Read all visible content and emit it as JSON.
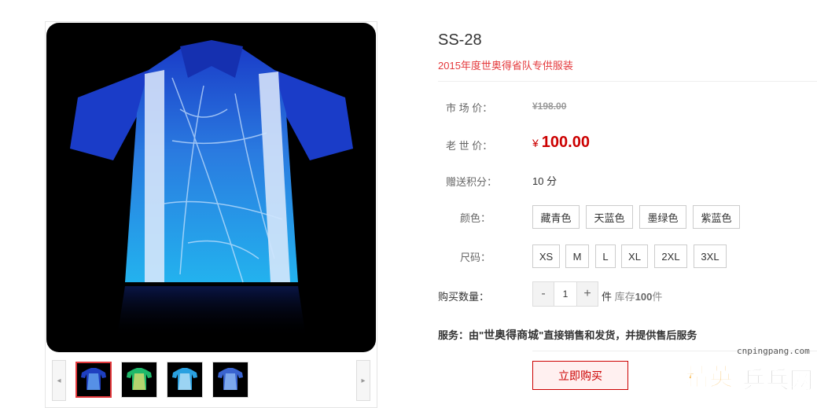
{
  "product": {
    "title": "SS-28",
    "subtitle": "2015年度世奥得省队专供服装",
    "market_price_label": "市 场 价：",
    "market_price": "¥198.00",
    "price_label": "老 世 价：",
    "currency": "¥",
    "price": "100.00",
    "points_label": "赠送积分：",
    "points": "10 分",
    "color_label": "颜色：",
    "colors": [
      "藏青色",
      "天蓝色",
      "墨绿色",
      "紫蓝色"
    ],
    "size_label": "尺码：",
    "sizes": [
      "XS",
      "M",
      "L",
      "XL",
      "2XL",
      "3XL"
    ],
    "qty_label": "购买数量：",
    "qty_minus": "-",
    "qty_value": "1",
    "qty_plus": "+",
    "qty_unit": "件",
    "stock_prefix": "库存",
    "stock_count": "100",
    "stock_suffix": "件",
    "service_prefix": "服务：由\"",
    "service_store": "世奥得商城",
    "service_suffix": "\"直接销售和发货，并提供售后服务",
    "buy_label": "立即购买"
  },
  "gallery": {
    "thumb_colors": [
      "#1e3fc0",
      "#1fb86a",
      "#2aa0e0",
      "#3a64d0"
    ],
    "prev_arrow": "◂",
    "next_arrow": "▸"
  },
  "watermark": {
    "url": "cnpingpang.com",
    "logo_text": "精英乒乓网"
  },
  "colors": {
    "accent": "#e4393c",
    "price": "#c00000",
    "shirt_blue": "#1a3cc8"
  }
}
